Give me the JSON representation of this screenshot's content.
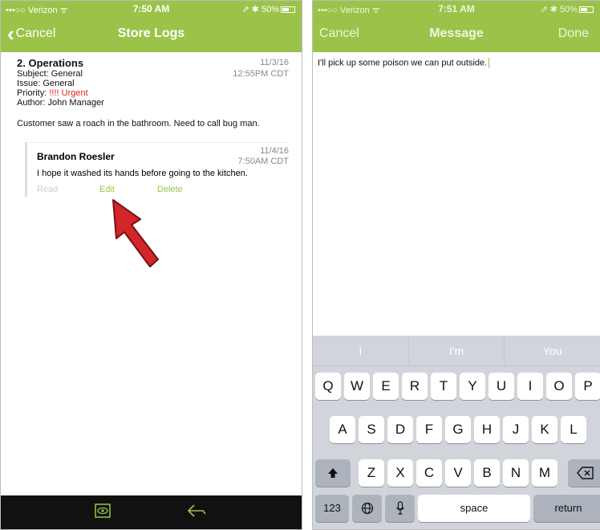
{
  "left": {
    "status": {
      "carrier": "•••○○ Verizon ᯤ",
      "time": "7:50 AM",
      "battery": "⇗ ✱ 50%"
    },
    "nav": {
      "back": "Cancel",
      "title": "Store Logs"
    },
    "log": {
      "title": "2. Operations",
      "date_line1": "11/3/16",
      "date_line2": "12:55PM CDT",
      "subject": "Subject: General",
      "issue": "Issue: General",
      "priority_label": "Priority: ",
      "priority_value": "!!!! Urgent",
      "author": "Author: John Manager",
      "body": "Customer saw a roach in the bathroom. Need to call bug man."
    },
    "comment": {
      "author": "Brandon Roesler",
      "date_line1": "11/4/16",
      "date_line2": "7:50AM CDT",
      "text": "I hope it washed its hands before going to the kitchen.",
      "actions": {
        "read": "Read",
        "edit": "Edit",
        "delete": "Delete"
      }
    },
    "tabbar": {
      "icons": [
        "eye-icon",
        "reply-icon"
      ]
    }
  },
  "right": {
    "status": {
      "carrier": "•••○○ Verizon ᯤ",
      "time": "7:51 AM",
      "battery": "⇗ ✱ 50%"
    },
    "nav": {
      "cancel": "Cancel",
      "title": "Message",
      "done": "Done"
    },
    "message": "I'll pick up some poison we can put outside.",
    "keyboard": {
      "suggestions": [
        "I",
        "I'm",
        "You"
      ],
      "row1": [
        "Q",
        "W",
        "E",
        "R",
        "T",
        "Y",
        "U",
        "I",
        "O",
        "P"
      ],
      "row2": [
        "A",
        "S",
        "D",
        "F",
        "G",
        "H",
        "J",
        "K",
        "L"
      ],
      "row3": [
        "Z",
        "X",
        "C",
        "V",
        "B",
        "N",
        "M"
      ],
      "numbers": "123",
      "space": "space",
      "return": "return"
    }
  },
  "colors": {
    "accent": "#9cc349",
    "urgent": "#e02020",
    "tabbar": "#111111",
    "keyboard": "#d1d5db"
  }
}
